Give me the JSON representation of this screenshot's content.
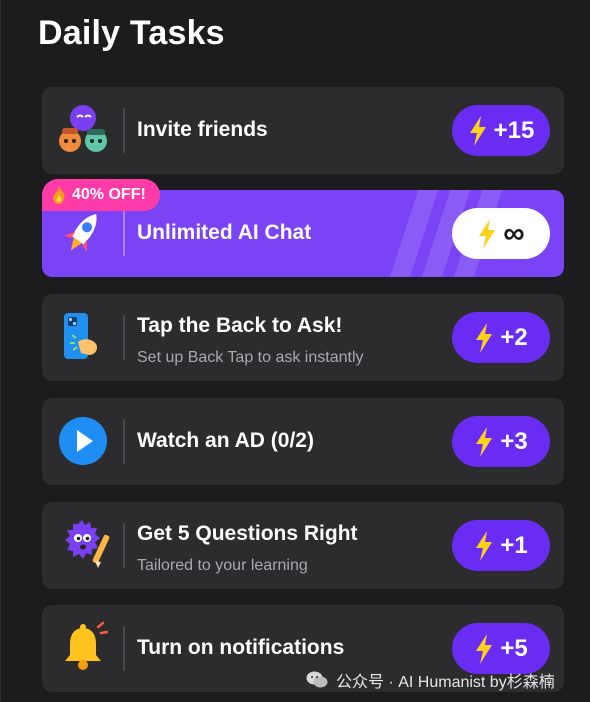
{
  "page": {
    "title": "Daily Tasks"
  },
  "tasks": [
    {
      "title": "Invite friends",
      "subtitle": "",
      "reward": "+15",
      "icon": "friends-icon"
    },
    {
      "title": "Unlimited AI Chat",
      "subtitle": "",
      "reward": "∞",
      "icon": "rocket-icon",
      "badge": "40% OFF!",
      "badge_icon": "flame-icon"
    },
    {
      "title": "Tap the Back to Ask!",
      "subtitle": "Set up Back Tap to ask instantly",
      "reward": "+2",
      "icon": "phone-tap-icon"
    },
    {
      "title": "Watch an AD (0/2)",
      "subtitle": "",
      "reward": "+3",
      "icon": "play-icon"
    },
    {
      "title": "Get 5 Questions Right",
      "subtitle": "Tailored to your learning",
      "reward": "+1",
      "icon": "monster-pencil-icon"
    },
    {
      "title": "Turn on notifications",
      "subtitle": "",
      "reward": "+5",
      "icon": "bell-icon"
    }
  ],
  "watermark": {
    "text": "公众号 · AI Humanist by杉森楠",
    "icon": "wechat-icon"
  },
  "colors": {
    "background": "#1c1c1e",
    "card": "#2c2c2e",
    "accent_purple": "#6a2cf2",
    "promo_purple": "#7a43f5",
    "badge_pink": "#ff3ba8",
    "bolt_yellow": "#ffd21a"
  }
}
